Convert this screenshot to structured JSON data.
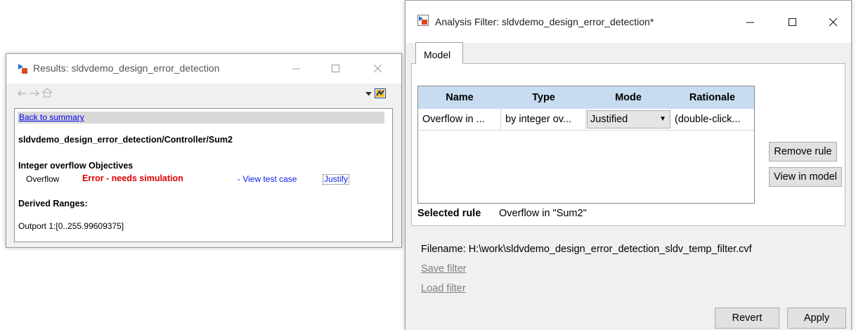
{
  "results": {
    "title": "Results: sldvdemo_design_error_detection",
    "toolbar": {
      "back_icon": "arrow-left-icon",
      "forward_icon": "arrow-right-icon",
      "home_icon": "home-icon"
    },
    "back_link": "Back to summary",
    "block_path": "sldvdemo_design_error_detection/Controller/Sum2",
    "objectives_heading": "Integer overflow Objectives",
    "objective": {
      "name": "Overflow",
      "status": "Error - needs simulation",
      "view_link": "- View test case",
      "justify_link": "Justify"
    },
    "derived_heading": "Derived Ranges:",
    "outport": "Outport 1:[0..255.99609375]",
    "status_color": "#e00000",
    "link_color": "#1020ee"
  },
  "filter": {
    "title": "Analysis Filter: sldvdemo_design_error_detection*",
    "tab": "Model",
    "columns": [
      "Name",
      "Type",
      "Mode",
      "Rationale"
    ],
    "row": {
      "name": "Overflow in ...",
      "type": "by integer ov...",
      "mode": "Justified",
      "rationale": "(double-click..."
    },
    "remove_rule": "Remove rule",
    "view_in_model": "View in model",
    "selected_rule_label": "Selected rule",
    "selected_rule_value": "Overflow in \"Sum2\"",
    "filename": "Filename: H:\\work\\sldvdemo_design_error_detection_sldv_temp_filter.cvf",
    "save_filter": "Save filter",
    "load_filter": "Load filter",
    "revert": "Revert",
    "apply": "Apply",
    "header_color": "#c7dcf0"
  }
}
